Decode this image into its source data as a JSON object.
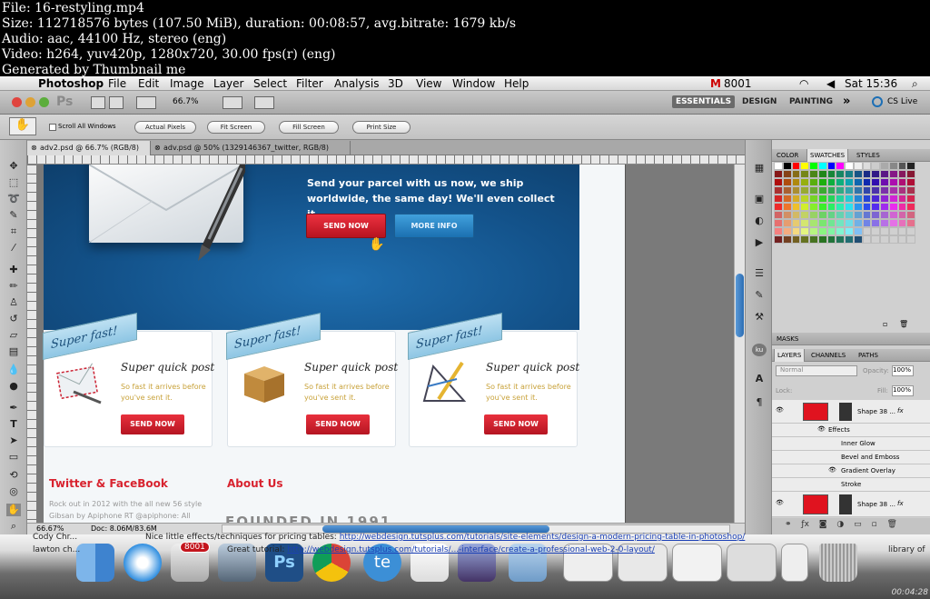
{
  "info_lines": [
    "File: 16-restyling.mp4",
    "Size: 112718576 bytes (107.50 MiB), duration: 00:08:57, avg.bitrate: 1679 kb/s",
    "Audio: aac, 44100 Hz, stereo (eng)",
    "Video: h264, yuv420p, 1280x720, 30.00 fps(r) (eng)",
    "Generated by Thumbnail me"
  ],
  "menubar": {
    "app": "Photoshop",
    "items": [
      "File",
      "Edit",
      "Image",
      "Layer",
      "Select",
      "Filter",
      "Analysis",
      "3D",
      "View",
      "Window",
      "Help"
    ],
    "status_text": "8001",
    "clock": "Sat 15:36"
  },
  "appbar": {
    "ps": "Ps",
    "zoom": "66.7%",
    "workspaces": [
      "ESSENTIALS",
      "DESIGN",
      "PAINTING"
    ],
    "more": "»",
    "cslive": "CS Live"
  },
  "options": {
    "scroll_all": "Scroll All Windows",
    "buttons": [
      "Actual Pixels",
      "Fit Screen",
      "Fill Screen",
      "Print Size"
    ]
  },
  "tabs": [
    "adv2.psd @ 66.7% (RGB/8)",
    "adv.psd @ 50% (1329146367_twitter, RGB/8)"
  ],
  "hero": {
    "headline": "Send your parcel with us now, we ship worldwide, the same day! We'll even collect it...",
    "send_now": "SEND NOW",
    "more_info": "MORE INFO"
  },
  "cards": [
    {
      "banner": "Super fast!",
      "title": "Super quick post",
      "text": "So fast it arrives before you've sent it.",
      "button": "SEND NOW"
    },
    {
      "banner": "Super fast!",
      "title": "Super quick post",
      "text": "So fast it arrives before you've sent it.",
      "button": "SEND NOW"
    },
    {
      "banner": "Super fast!",
      "title": "Super quick post",
      "text": "So fast it arrives before you've sent it.",
      "button": "SEND NOW"
    }
  ],
  "footer": {
    "twitter": "Twitter & FaceBook",
    "about": "About Us",
    "tweet1": "Rock out in 2012 with the all new 56 style",
    "tweet2": "Gibsan by Apiphone RT @apiphone: All",
    "founded": "FOUNDED IN 1991"
  },
  "status": {
    "zoom": "66.67%",
    "doc": "Doc: 8.06M/83.6M"
  },
  "panels": {
    "swatch_tabs": [
      "COLOR",
      "SWATCHES",
      "STYLES"
    ],
    "masks": "MASKS",
    "layer_tabs": [
      "LAYERS",
      "CHANNELS",
      "PATHS"
    ],
    "blend": "Normal",
    "opacity_label": "Opacity:",
    "opacity": "100%",
    "lock": "Lock:",
    "fill_label": "Fill:",
    "fill": "100%",
    "layers": [
      {
        "name": "Shape 38 ...",
        "fx": "fx"
      },
      {
        "name": "Effects"
      },
      {
        "name": "Inner Glow"
      },
      {
        "name": "Bevel and Emboss"
      },
      {
        "name": "Gradient Overlay"
      },
      {
        "name": "Stroke"
      },
      {
        "name": "Shape 38 ...",
        "fx": "fx"
      }
    ]
  },
  "bottom": {
    "cody": "Cody Chr...",
    "lawton": "lawton ch...",
    "tip": "Nice little effects/techniques for pricing tables:",
    "url1": "http://webdesign.tutsplus.com/tutorials/site-elements/design-a-modern-pricing-table-in-photoshop/",
    "tip2": "Great tutorial:",
    "url2": "http://webdesign.tutsplus.com/tutorials/...-interface/create-a-professional-web-2-0-layout/",
    "lib": "library of",
    "badge": "8001"
  },
  "timecode": "00:04:28",
  "colors": {
    "accent_red": "#d8232f",
    "hero_blue": "#13528a",
    "banner_blue": "#a9d5ee",
    "text_gold": "#c8a23a"
  }
}
